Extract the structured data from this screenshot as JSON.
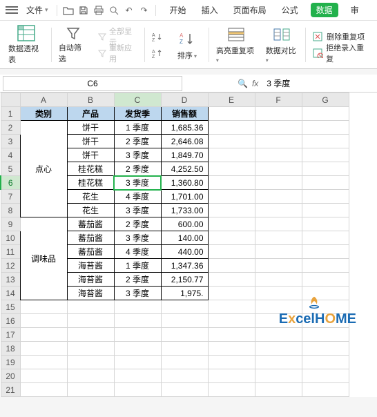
{
  "menu": {
    "file": "文件",
    "tabs": [
      "开始",
      "插入",
      "页面布局",
      "公式",
      "数据",
      "审"
    ]
  },
  "ribbon": {
    "pivot": "数据透视表",
    "autofilter": "自动筛选",
    "showall": "全部显示",
    "reapply": "重新应用",
    "sort": "排序",
    "highlight": "高亮重复项",
    "compare": "数据对比",
    "removedup": "删除重复项",
    "rejectdup": "拒绝录入重复"
  },
  "namebox": "C6",
  "formula": "3 季度",
  "cols": [
    "A",
    "B",
    "C",
    "D",
    "E",
    "F",
    "G"
  ],
  "headers": [
    "类别",
    "产品",
    "发货季",
    "销售额"
  ],
  "rows": [
    {
      "r": 2,
      "b": "饼干",
      "c": "1 季度",
      "d": "1,685.36"
    },
    {
      "r": 3,
      "b": "饼干",
      "c": "2 季度",
      "d": "2,646.08"
    },
    {
      "r": 4,
      "b": "饼干",
      "c": "3 季度",
      "d": "1,849.70"
    },
    {
      "r": 5,
      "b": "桂花糕",
      "c": "2 季度",
      "d": "4,252.50"
    },
    {
      "r": 6,
      "b": "桂花糕",
      "c": "3 季度",
      "d": "1,360.80"
    },
    {
      "r": 7,
      "b": "花生",
      "c": "4 季度",
      "d": "1,701.00"
    },
    {
      "r": 8,
      "b": "花生",
      "c": "3 季度",
      "d": "1,733.00"
    },
    {
      "r": 9,
      "b": "蕃茄酱",
      "c": "2 季度",
      "d": "600.00"
    },
    {
      "r": 10,
      "b": "蕃茄酱",
      "c": "3 季度",
      "d": "140.00"
    },
    {
      "r": 11,
      "b": "蕃茄酱",
      "c": "4 季度",
      "d": "440.00"
    },
    {
      "r": 12,
      "b": "海苔酱",
      "c": "1 季度",
      "d": "1,347.36"
    },
    {
      "r": 13,
      "b": "海苔酱",
      "c": "2 季度",
      "d": "2,150.77"
    },
    {
      "r": 14,
      "b": "海苔酱",
      "c": "3 季度",
      "d": "1,975."
    }
  ],
  "cat1": "点心",
  "cat2": "调味品",
  "watermark": {
    "part1": "E",
    "part2": "x",
    "part3": "celH",
    "part4": "O",
    "part5": "ME"
  }
}
